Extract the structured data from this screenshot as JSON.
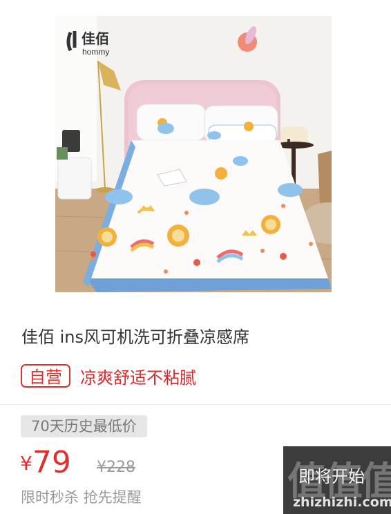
{
  "product": {
    "brand_logo_cn": "佳佰",
    "brand_logo_en": "hommy",
    "title": "佳佰 ins风可机洗可折叠凉感席",
    "self_badge": "自营",
    "slogan": "凉爽舒适不粘腻"
  },
  "pricing": {
    "low_price_badge": "70天历史最低价",
    "currency": "¥",
    "price": "79",
    "original_price": "¥228",
    "flash_text": "限时秒杀 抢先提醒"
  },
  "cta": {
    "label": "即将开始",
    "watermark": "值值值",
    "watermark_domain": "zhizhizhi.com"
  },
  "colors": {
    "accent_red": "#e0302d",
    "cta_bg": "#3c3c3c",
    "headboard_pink": "#ecc5cf",
    "sheet_border_blue": "#6fa0d8"
  }
}
